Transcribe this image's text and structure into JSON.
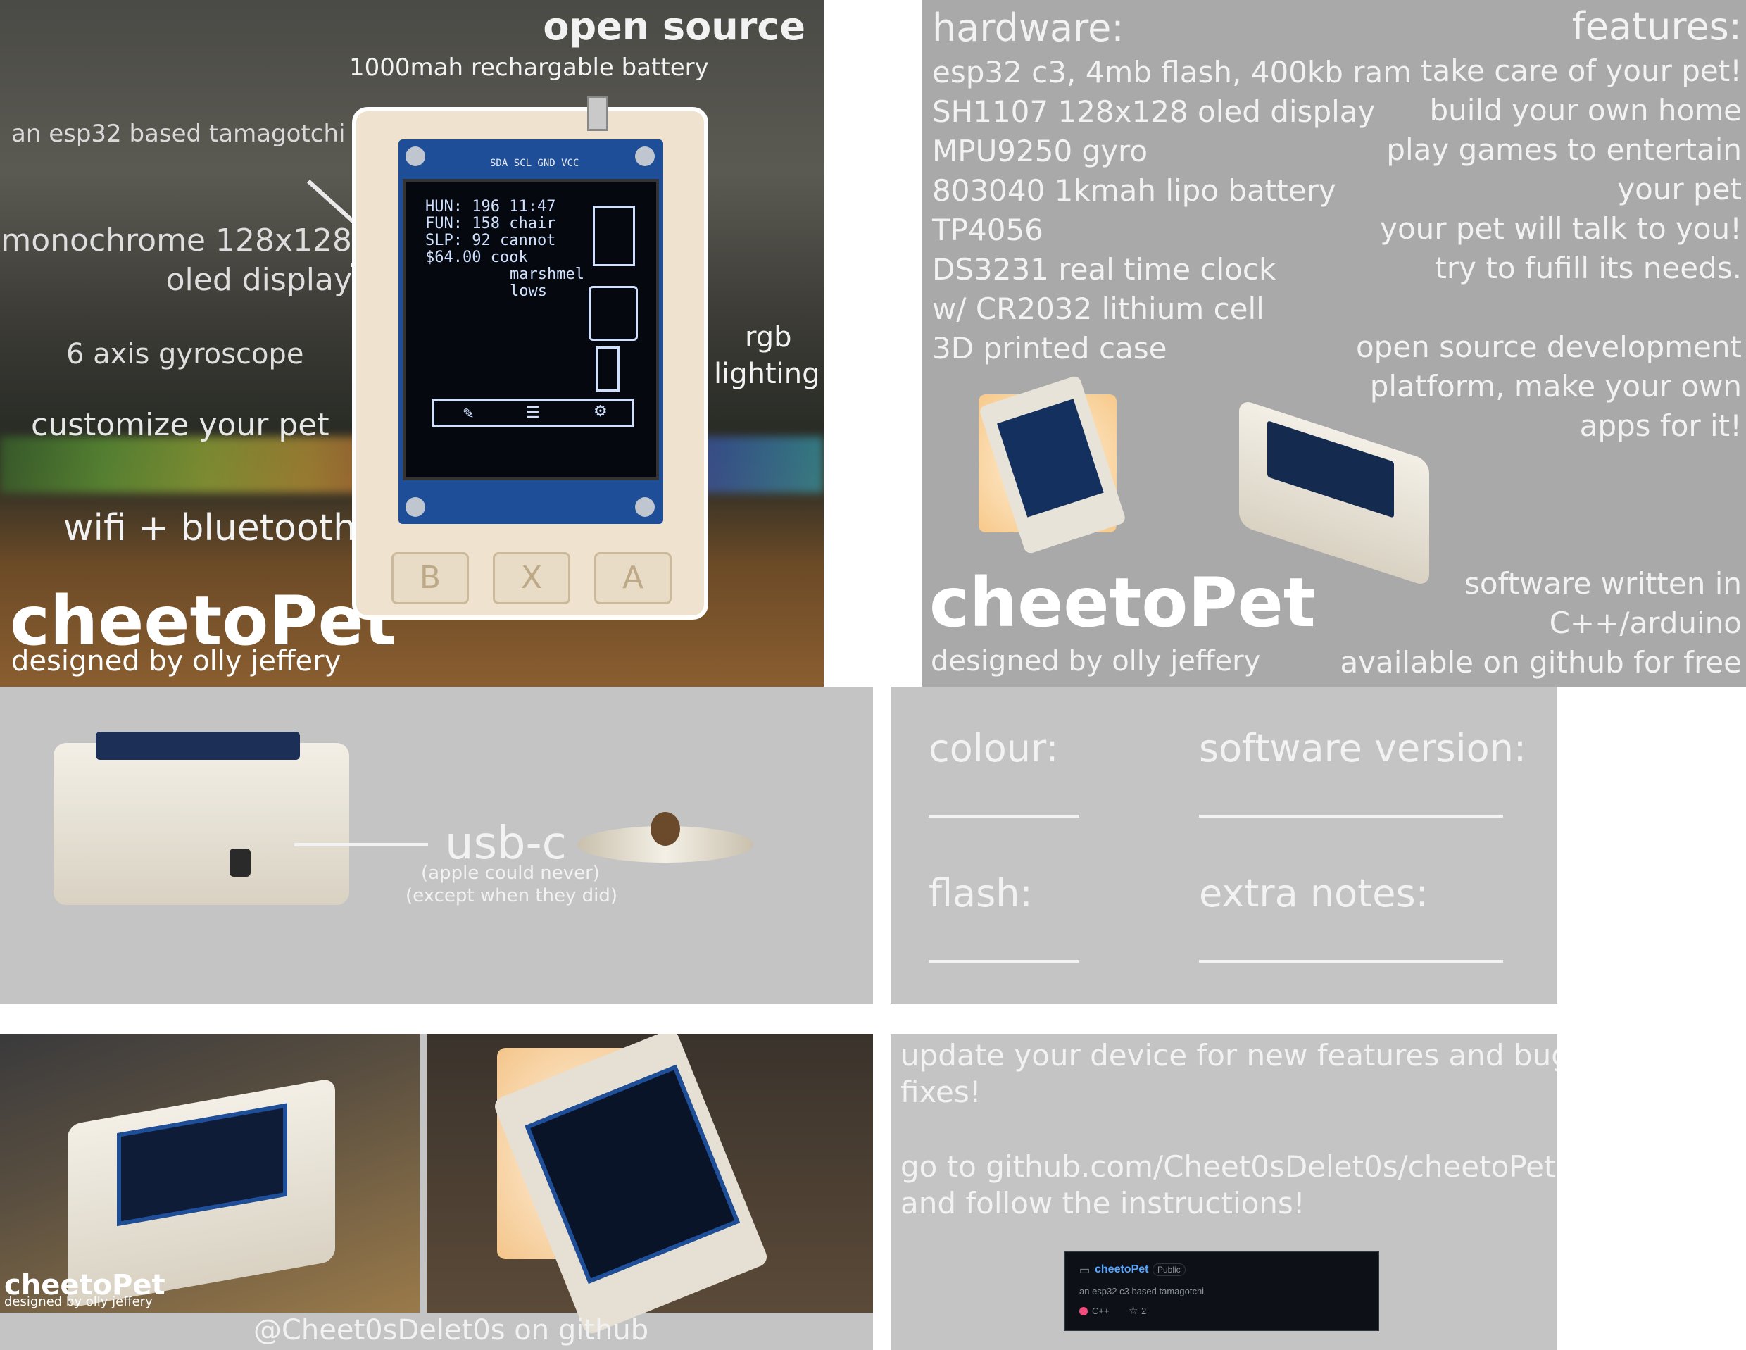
{
  "photo_main": {
    "open_source": "open source",
    "battery": "1000mah rechargable battery",
    "esp32": "an esp32 based tamagotchi",
    "display_line1": "monochrome 128x128",
    "display_line2": "oled display",
    "gyro": "6 axis gyroscope",
    "customize": "customize your pet",
    "wifi": "wifi + bluetooth",
    "rgb_line1": "rgb",
    "rgb_line2": "lighting",
    "brand": "cheetoPet",
    "designed_by": "designed by olly jeffery",
    "pcb_pins": "SDA SCL GND VCC",
    "screen": {
      "line1": "HUN: 196 11:47",
      "line2": "FUN: 158 chair",
      "line3": "SLP: 92 cannot",
      "line4": "$64.00 cook",
      "line5": "marshmel",
      "line6": "lows"
    },
    "buttons": [
      "B",
      "X",
      "A"
    ]
  },
  "spec_panel": {
    "hardware_title": "hardware:",
    "hardware_items": [
      "esp32 c3, 4mb flash, 400kb ram",
      "SH1107 128x128 oled display",
      "MPU9250 gyro",
      "803040 1kmah lipo battery",
      "TP4056",
      "DS3231 real time clock",
      "w/ CR2032 lithium cell",
      "3D printed case"
    ],
    "features_title": "features:",
    "features_items": [
      "take care of your pet!",
      "build your own home",
      "play games to entertain",
      "your pet",
      "your pet will talk to you!",
      "try to fufill its needs."
    ],
    "dev_items": [
      "open source development",
      "platform, make your own",
      "apps for it!"
    ],
    "software_items": [
      "software written in",
      "C++/arduino",
      "available on github for free"
    ],
    "brand": "cheetoPet",
    "designed_by": "designed by olly jeffery"
  },
  "usb_panel": {
    "title": "usb-c",
    "sub1": "(apple could never)",
    "sub2": "(except when they did)"
  },
  "form_panel": {
    "colour": "colour:",
    "software_version": "software version:",
    "flash": "flash:",
    "extra_notes": "extra notes:"
  },
  "photos_panel": {
    "brand": "cheetoPet",
    "designed_by": "designed by olly jeffery",
    "github_handle": "@Cheet0sDelet0s on github"
  },
  "update_panel": {
    "line1": "update your device for new features and bug",
    "line2": "fixes!",
    "line3": "go to github.com/Cheet0sDelet0s/cheetoPet",
    "line4": "and follow the instructions!",
    "repo_card": {
      "name": "cheetoPet",
      "visibility": "Public",
      "description": "an esp32 c3 based tamagotchi",
      "language": "C++",
      "stars": "2"
    }
  },
  "colors": {
    "panel_gray": "#c4c4c4",
    "spec_gray": "#a9a9a9",
    "text_white": "#f2f2f2",
    "cpp_dot": "#f34b7d"
  }
}
